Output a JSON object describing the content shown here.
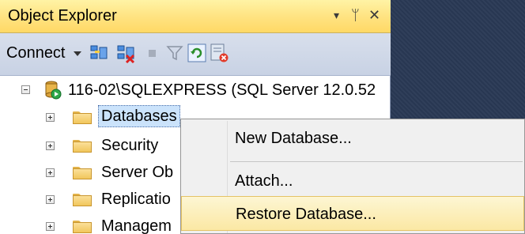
{
  "panel": {
    "title": "Object Explorer",
    "title_icons": [
      "dropdown-arrow-icon",
      "pin-icon",
      "close-icon"
    ],
    "glyphs": {
      "dropdown": "▾",
      "pin": "ᛘ",
      "close": "✕"
    }
  },
  "toolbar": {
    "connect_label": "Connect",
    "tools": [
      "connect-object-explorer-icon",
      "disconnect-icon",
      "stop-icon",
      "filter-icon",
      "refresh-icon",
      "activity-monitor-icon"
    ]
  },
  "tree": {
    "server": "116-02\\SQLEXPRESS (SQL Server 12.0.52",
    "items": [
      {
        "label": "Databases",
        "selected": true
      },
      {
        "label": "Security",
        "selected": false
      },
      {
        "label": "Server Ob",
        "selected": false
      },
      {
        "label": "Replicatio",
        "selected": false
      },
      {
        "label": "Managem",
        "selected": false
      }
    ]
  },
  "context_menu": {
    "items": [
      {
        "label": "New Database...",
        "hover": false
      },
      {
        "label": "Attach...",
        "hover": false
      },
      {
        "label": "Restore Database...",
        "hover": true
      }
    ]
  },
  "colors": {
    "titlebar": "#ffe27f",
    "selection": "#cbe3fb",
    "menu_hover": "#fbe8a4",
    "background": "#293955"
  }
}
